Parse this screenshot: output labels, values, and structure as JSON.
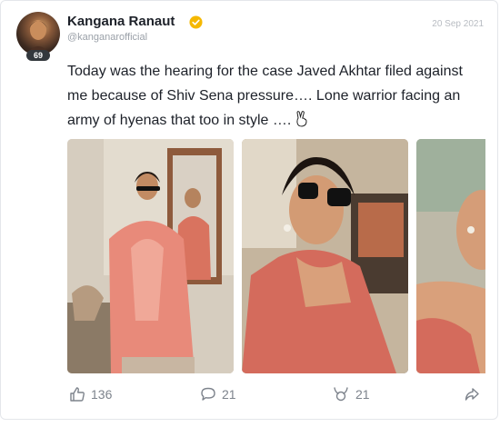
{
  "post": {
    "author_name": "Kangana Ranaut",
    "handle": "@kanganarofficial",
    "date": "20 Sep 2021",
    "avatar_badge": "69",
    "text": "Today was the hearing for the case Javed Akhtar filed against me because of Shiv Sena pressure…. Lone warrior facing an army of hyenas that too in style ….",
    "emoji_icon": "victory-hand-icon"
  },
  "actions": {
    "likes": "136",
    "comments": "21",
    "reposts": "21"
  },
  "icons": {
    "verified": "verified-badge-icon",
    "like": "thumbs-up-icon",
    "comment": "comment-bubble-icon",
    "repost": "repost-icon",
    "share": "share-arrow-icon"
  },
  "colors": {
    "verified": "#f5b800",
    "text": "#1d2129",
    "muted": "#7d838c",
    "badge_bg": "#33383d",
    "saree": "#e88a7a"
  }
}
